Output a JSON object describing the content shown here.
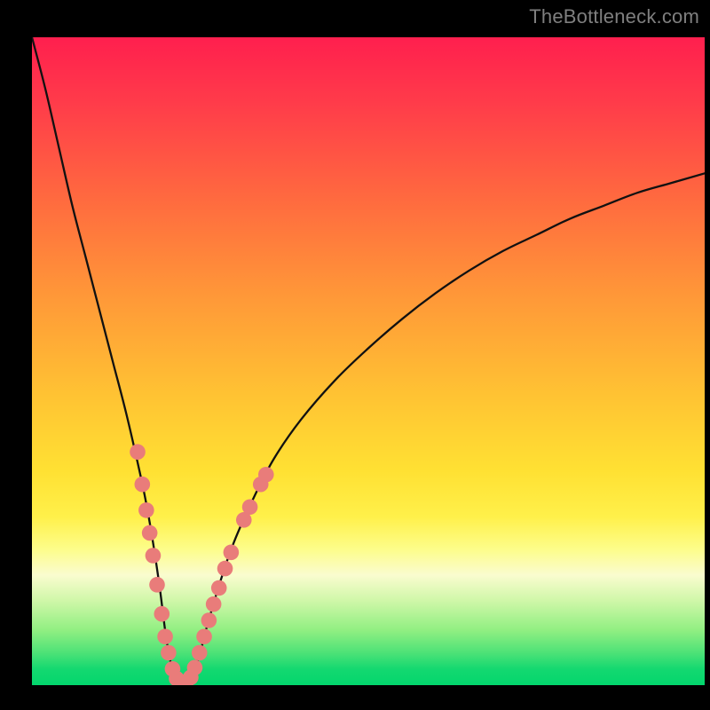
{
  "watermark": "TheBottleneck.com",
  "colors": {
    "frame": "#000000",
    "curve": "#111111",
    "marker_fill": "#e97c7a",
    "marker_stroke": "#e97c7a",
    "watermark_text": "#7f7f7f"
  },
  "chart_data": {
    "type": "line",
    "title": "",
    "xlabel": "",
    "ylabel": "",
    "xlim": [
      0,
      100
    ],
    "ylim": [
      0,
      100
    ],
    "grid": false,
    "legend": "none",
    "annotations": [
      "TheBottleneck.com"
    ],
    "series": [
      {
        "name": "bottleneck-curve",
        "x": [
          0,
          2,
          4,
          6,
          8,
          10,
          12,
          14,
          16,
          17,
          18,
          19,
          20,
          21,
          22,
          23,
          24,
          25,
          26,
          28,
          30,
          33,
          36,
          40,
          45,
          50,
          55,
          60,
          65,
          70,
          75,
          80,
          85,
          90,
          95,
          100
        ],
        "values": [
          100,
          92,
          83,
          74,
          66,
          58,
          50,
          42,
          33,
          28,
          22,
          15,
          7,
          2,
          0.5,
          0.5,
          2,
          5,
          9,
          16,
          22,
          29,
          35,
          41,
          47,
          52,
          56.5,
          60.5,
          64,
          67,
          69.5,
          72,
          74,
          76,
          77.5,
          79
        ]
      }
    ],
    "markers": [
      {
        "x": 15.7,
        "y": 36
      },
      {
        "x": 16.4,
        "y": 31
      },
      {
        "x": 17.0,
        "y": 27
      },
      {
        "x": 17.5,
        "y": 23.5
      },
      {
        "x": 18.0,
        "y": 20
      },
      {
        "x": 18.6,
        "y": 15.5
      },
      {
        "x": 19.3,
        "y": 11
      },
      {
        "x": 19.8,
        "y": 7.5
      },
      {
        "x": 20.3,
        "y": 5
      },
      {
        "x": 20.9,
        "y": 2.5
      },
      {
        "x": 21.5,
        "y": 1
      },
      {
        "x": 22.2,
        "y": 0.5
      },
      {
        "x": 22.9,
        "y": 0.5
      },
      {
        "x": 23.6,
        "y": 1.2
      },
      {
        "x": 24.2,
        "y": 2.7
      },
      {
        "x": 24.9,
        "y": 5
      },
      {
        "x": 25.6,
        "y": 7.5
      },
      {
        "x": 26.3,
        "y": 10
      },
      {
        "x": 27.0,
        "y": 12.5
      },
      {
        "x": 27.8,
        "y": 15
      },
      {
        "x": 28.7,
        "y": 18
      },
      {
        "x": 29.6,
        "y": 20.5
      },
      {
        "x": 31.5,
        "y": 25.5
      },
      {
        "x": 32.4,
        "y": 27.5
      },
      {
        "x": 34.0,
        "y": 31.0
      },
      {
        "x": 34.8,
        "y": 32.5
      }
    ],
    "background_gradient_stops": [
      {
        "pos": 0.0,
        "color": "#ff1f4e"
      },
      {
        "pos": 0.1,
        "color": "#ff3b4a"
      },
      {
        "pos": 0.25,
        "color": "#ff6a3f"
      },
      {
        "pos": 0.4,
        "color": "#ff9838"
      },
      {
        "pos": 0.55,
        "color": "#ffc233"
      },
      {
        "pos": 0.67,
        "color": "#ffe133"
      },
      {
        "pos": 0.74,
        "color": "#fff04a"
      },
      {
        "pos": 0.79,
        "color": "#fdfd8a"
      },
      {
        "pos": 0.83,
        "color": "#fafccf"
      },
      {
        "pos": 0.87,
        "color": "#cff7a8"
      },
      {
        "pos": 0.915,
        "color": "#91ef82"
      },
      {
        "pos": 0.95,
        "color": "#4de277"
      },
      {
        "pos": 0.975,
        "color": "#14d870"
      },
      {
        "pos": 1.0,
        "color": "#03d66d"
      }
    ]
  }
}
